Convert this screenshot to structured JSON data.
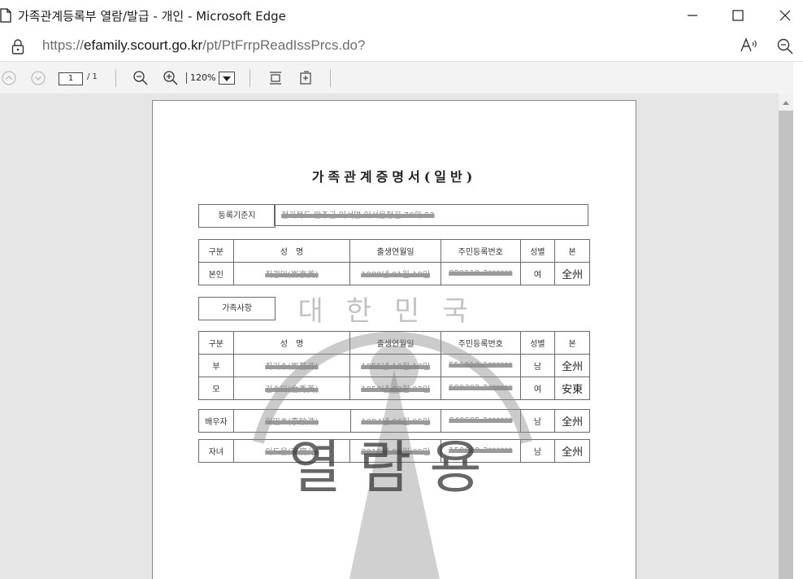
{
  "window": {
    "title": "가족관계등록부 열람/발급 - 개인 - Microsoft Edge"
  },
  "address": {
    "scheme": "https://",
    "host": "efamily.scourt.go.kr",
    "path": "/pt/PtFrrpReadIssPrcs.do?"
  },
  "pdf_toolbar": {
    "page_current": "1",
    "page_total": "/ 1",
    "zoom": "120%"
  },
  "document": {
    "title": "가족관계증명서(일반)",
    "registry_label": "등록기준지",
    "registry_value": "전라북도 완주군 이서면 이서윤정길 70의 93",
    "columns": [
      "구분",
      "성　명",
      "출생연월일",
      "주민등록번호",
      "성별",
      "본"
    ],
    "self_row": {
      "type": "본인",
      "name": "최경미(崔京美)",
      "birth": "1988년 01월 19일",
      "id": "880119-2******",
      "gender": "여",
      "origin": "全州"
    },
    "family_label": "가족사항",
    "family_columns": [
      "구분",
      "성　명",
      "출생연월일",
      "주민등록번호",
      "성별",
      "본"
    ],
    "family_rows": [
      {
        "type": "부",
        "name": "최기수(崔基洙)",
        "birth": "1955년 10월 10일",
        "id": "551010-1******",
        "gender": "남",
        "origin": "全州"
      },
      {
        "type": "모",
        "name": "김수미(金秀美)",
        "birth": "1958년 03월 02일",
        "id": "580302-2******",
        "gender": "여",
        "origin": "安東"
      }
    ],
    "spouse_row": {
      "type": "배우자",
      "name": "이민호(李敏浩)",
      "birth": "1984년 06월 05일",
      "id": "840605-1******",
      "gender": "남",
      "origin": "全州"
    },
    "child_row": {
      "type": "자녀",
      "name": "이도윤(李度允)",
      "birth": "2015년 06월 09일",
      "id": "150609-3******",
      "gender": "남",
      "origin": "全州"
    },
    "watermark_seal": "대한민국",
    "watermark_text": "열람용"
  }
}
